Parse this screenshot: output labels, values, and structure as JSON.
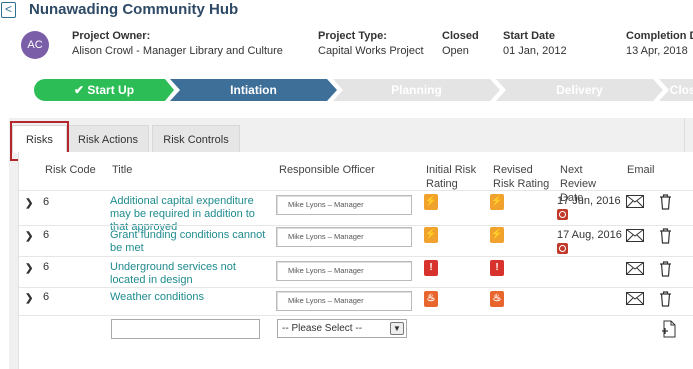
{
  "app": {
    "title": "Nunawading Community Hub",
    "back_glyph": "<"
  },
  "project": {
    "avatar_initials": "AC",
    "owner_label": "Project Owner:",
    "owner_value": "Alison Crowl - Manager Library and Culture",
    "type_label": "Project Type:",
    "type_value": "Capital Works Project",
    "status_label": "Closed",
    "status_value": "Open",
    "start_label": "Start Date",
    "start_value": "01 Jan, 2012",
    "completion_label": "Completion Da",
    "completion_value": "13 Apr, 2018"
  },
  "stages": [
    {
      "label": "✔ Start Up",
      "state": "done",
      "color": "#2dbd57"
    },
    {
      "label": "Intiation",
      "state": "current",
      "color": "#3d6f99"
    },
    {
      "label": "Planning",
      "state": "pending",
      "color": "#e4e4e4"
    },
    {
      "label": "Delivery",
      "state": "pending",
      "color": "#e4e4e4"
    },
    {
      "label": "Closure",
      "state": "pending",
      "color": "#e4e4e4"
    }
  ],
  "tabs": [
    {
      "label": "Risks",
      "active": true
    },
    {
      "label": "Risk Actions",
      "active": false
    },
    {
      "label": "Risk Controls",
      "active": false
    }
  ],
  "table": {
    "headers": {
      "code": "Risk Code",
      "title": "Title",
      "officer": "Responsible Officer",
      "initial": "Initial Risk Rating",
      "revised": "Revised Risk Rating",
      "review": "Next Review Date",
      "email": "Email"
    },
    "rows": [
      {
        "code": "6",
        "title": "Additional capital expenditure may be required in addition to that approved",
        "officer": "Mike Lyons – Manager",
        "initial": "high",
        "revised": "high",
        "review_date": "17 Jun, 2016",
        "overdue": true
      },
      {
        "code": "6",
        "title": "Grant funding conditions cannot be met",
        "officer": "Mike Lyons – Manager",
        "initial": "high",
        "revised": "high",
        "review_date": "17 Aug, 2016",
        "overdue": true
      },
      {
        "code": "6",
        "title": "Underground services not located in design",
        "officer": "Mike Lyons – Manager",
        "initial": "extreme",
        "revised": "extreme",
        "review_date": "",
        "overdue": false
      },
      {
        "code": "6",
        "title": "Weather conditions",
        "officer": "Mike Lyons – Manager",
        "initial": "fire",
        "revised": "fire",
        "review_date": "",
        "overdue": false
      }
    ],
    "new_row": {
      "title_value": "",
      "officer_select": "-- Please Select --"
    }
  },
  "colors": {
    "link": "#1f8b8e",
    "focus_outline": "#b4262b",
    "amber": "#f0a22c",
    "red": "#d7332c"
  },
  "icons": {
    "expand": "chevron-right-icon",
    "email": "mail-icon",
    "delete": "trash-icon",
    "overdue": "clock-icon",
    "add": "add-document-icon"
  }
}
